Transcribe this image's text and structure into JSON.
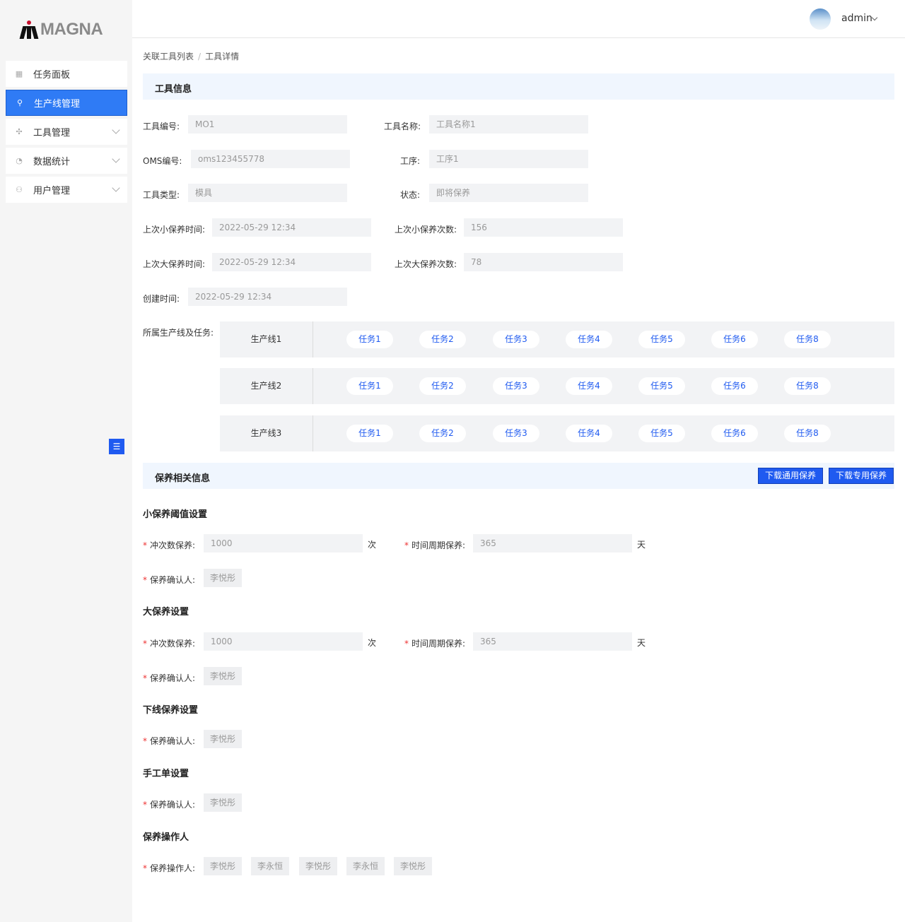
{
  "brand": {
    "logo_text": "MAGNA"
  },
  "sidebar": {
    "items": [
      {
        "label": "任务面板",
        "icon": "grid-icon"
      },
      {
        "label": "生产线管理",
        "icon": "org-chart-icon"
      },
      {
        "label": "工具管理",
        "icon": "tool-icon"
      },
      {
        "label": "数据统计",
        "icon": "chart-icon"
      },
      {
        "label": "用户管理",
        "icon": "users-icon"
      }
    ],
    "collapse_icon": "☰"
  },
  "header": {
    "user": "admin"
  },
  "breadcrumb": {
    "parent": "关联工具列表",
    "current": "工具详情",
    "separator": "/"
  },
  "tool_info": {
    "title": "工具信息",
    "tool_no_label": "工具编号:",
    "tool_no": "MO1",
    "tool_name_label": "工具名称:",
    "tool_name": "工具名称1",
    "oms_label": "OMS编号:",
    "oms": "oms123455778",
    "process_label": "工序:",
    "process": "工序1",
    "type_label": "工具类型:",
    "type": "模具",
    "status_label": "状态:",
    "status": "即将保养",
    "last_minor_time_label": "上次小保养时间:",
    "last_minor_time": "2022-05-29 12:34",
    "last_minor_count_label": "上次小保养次数:",
    "last_minor_count": "156",
    "last_major_time_label": "上次大保养时间:",
    "last_major_time": "2022-05-29 12:34",
    "last_major_count_label": "上次大保养次数:",
    "last_major_count": "78",
    "created_label": "创建时间:",
    "created": "2022-05-29 12:34",
    "lines_label": "所属生产线及任务:"
  },
  "production_lines": [
    {
      "name": "生产线1",
      "tasks": [
        "任务1",
        "任务2",
        "任务3",
        "任务4",
        "任务5",
        "任务6",
        "任务8"
      ]
    },
    {
      "name": "生产线2",
      "tasks": [
        "任务1",
        "任务2",
        "任务3",
        "任务4",
        "任务5",
        "任务6",
        "任务8"
      ]
    },
    {
      "name": "生产线3",
      "tasks": [
        "任务1",
        "任务2",
        "任务3",
        "任务4",
        "任务5",
        "任务6",
        "任务8"
      ]
    }
  ],
  "maintenance": {
    "title": "保养相关信息",
    "download_general": "下载通用保养",
    "download_special": "下载专用保养",
    "required_mark": "*",
    "minor": {
      "title": "小保养阈值设置",
      "stroke_label": "冲次数保养:",
      "stroke": "1000",
      "stroke_unit": "次",
      "period_label": "时间周期保养:",
      "period": "365",
      "period_unit": "天",
      "confirmer_label": "保养确认人:",
      "confirmer": "李悦彤"
    },
    "major": {
      "title": "大保养设置",
      "stroke_label": "冲次数保养:",
      "stroke": "1000",
      "stroke_unit": "次",
      "period_label": "时间周期保养:",
      "period": "365",
      "period_unit": "天",
      "confirmer_label": "保养确认人:",
      "confirmer": "李悦彤"
    },
    "offline": {
      "title": "下线保养设置",
      "confirmer_label": "保养确认人:",
      "confirmer": "李悦彤"
    },
    "manual": {
      "title": "手工单设置",
      "confirmer_label": "保养确认人:",
      "confirmer": "李悦彤"
    },
    "operators": {
      "title": "保养操作人",
      "label": "保养操作人:",
      "names": [
        "李悦彤",
        "李永恒",
        "李悦彤",
        "李永恒",
        "李悦彤"
      ]
    }
  }
}
